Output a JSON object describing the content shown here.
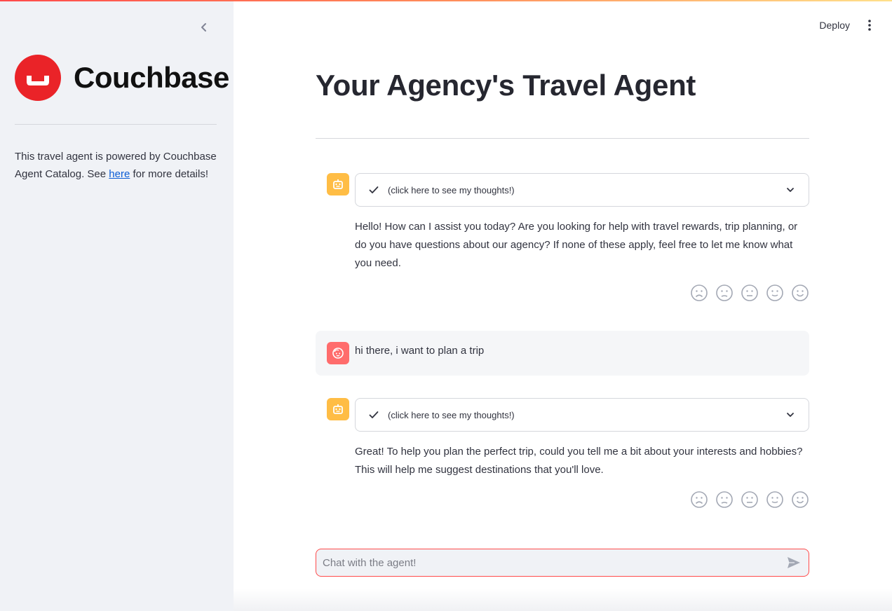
{
  "sidebar": {
    "logo_text": "Couchbase",
    "description_prefix": "This travel agent is powered by Couchbase Agent Catalog. See ",
    "link_text": "here",
    "description_suffix": " for more details!"
  },
  "header": {
    "deploy_label": "Deploy"
  },
  "main": {
    "title": "Your Agency's Travel Agent"
  },
  "messages": [
    {
      "role": "assistant",
      "thoughts_label": "(click here to see my thoughts!)",
      "text": "Hello! How can I assist you today? Are you looking for help with travel rewards, trip planning, or do you have questions about our agency? If none of these apply, feel free to let me know what you need."
    },
    {
      "role": "user",
      "text": "hi there, i want to plan a trip"
    },
    {
      "role": "assistant",
      "thoughts_label": "(click here to see my thoughts!)",
      "text": "Great! To help you plan the perfect trip, could you tell me a bit about your interests and hobbies? This will help me suggest destinations that you'll love."
    }
  ],
  "chat_input": {
    "placeholder": "Chat with the agent!"
  },
  "feedback_icons": [
    "frowning-face-icon",
    "slightly-frowning-face-icon",
    "neutral-face-icon",
    "slightly-smiling-face-icon",
    "smiling-face-icon"
  ],
  "colors": {
    "brand_red": "#ea2328",
    "bot_avatar": "#ffbd45",
    "user_avatar": "#ff6c6c",
    "input_border": "#ff4b4b",
    "link": "#0b5cd5"
  }
}
